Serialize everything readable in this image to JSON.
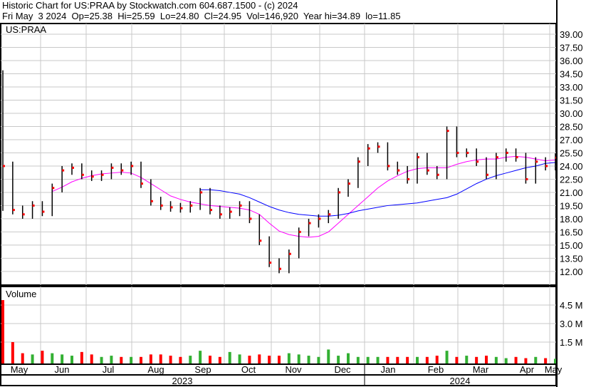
{
  "header": {
    "title": "Historic Chart for US:PRAA by Stockwatch.com 604.687.1500 - (c) 2024",
    "quote": "Fri May  3 2024  Op=25.38  Hi=25.59  Lo=24.80  Cl=24.95  Vol=146,920  Year hi=34.89  lo=11.85"
  },
  "chart_data": [
    {
      "type": "ohlc",
      "symbol": "US:PRAA",
      "ylim": [
        11,
        40.2
      ],
      "yticks": [
        "39.00",
        "37.50",
        "36.00",
        "34.50",
        "33.00",
        "31.50",
        "30.00",
        "28.50",
        "27.00",
        "25.50",
        "24.00",
        "22.50",
        "21.00",
        "19.50",
        "18.00",
        "16.50",
        "15.00",
        "13.50",
        "12.00"
      ],
      "first_bar": {
        "open": 25.0,
        "high": 34.89,
        "low": 18.9,
        "close": 24.0
      },
      "close": [
        24.0,
        19.0,
        18.5,
        19.5,
        18.8,
        21.5,
        23.5,
        23.8,
        23.0,
        22.8,
        23.0,
        23.8,
        23.5,
        24.0,
        22.0,
        20.0,
        19.5,
        19.3,
        19.2,
        19.5,
        21.0,
        19.0,
        18.5,
        18.8,
        19.5,
        18.0,
        15.5,
        13.0,
        12.3,
        14.0,
        16.5,
        17.5,
        18.0,
        18.5,
        21.0,
        22.0,
        24.5,
        26.0,
        26.2,
        24.0,
        23.5,
        22.5,
        25.0,
        23.5,
        23.0,
        28.0,
        25.5,
        25.5,
        24.5,
        23.0,
        25.0,
        25.5,
        25.0,
        22.5,
        24.5,
        24.0,
        24.95
      ],
      "ma_short": {
        "start_week": 5,
        "color": "#ff00ff",
        "values": [
          21.1,
          21.6,
          22.2,
          22.6,
          22.9,
          23.1,
          23.2,
          23.3,
          23.2,
          22.7,
          22.0,
          21.3,
          20.6,
          20.2,
          19.9,
          19.7,
          19.5,
          19.4,
          19.3,
          19.2,
          19.0,
          18.5,
          17.5,
          16.6,
          16.2,
          16.0,
          15.9,
          16.0,
          16.5,
          17.5,
          18.5,
          19.5,
          20.5,
          21.5,
          22.3,
          22.9,
          23.4,
          23.7,
          23.8,
          23.8,
          23.8,
          24.2,
          24.5,
          24.7,
          24.8,
          24.8,
          25.0,
          25.1,
          25.0,
          24.8,
          24.6,
          24.7
        ]
      },
      "ma_long": {
        "start_week": 20,
        "color": "#0000ff",
        "values": [
          21.3,
          21.3,
          21.2,
          21.0,
          20.8,
          20.4,
          19.9,
          19.4,
          19.0,
          18.7,
          18.5,
          18.4,
          18.3,
          18.3,
          18.4,
          18.6,
          18.9,
          19.1,
          19.3,
          19.5,
          19.6,
          19.7,
          19.8,
          20.0,
          20.2,
          20.4,
          20.8,
          21.4,
          22.0,
          22.5,
          22.9,
          23.2,
          23.5,
          23.8,
          24.0,
          24.3,
          24.4
        ]
      }
    },
    {
      "type": "bar",
      "title": "Volume",
      "unit": "M",
      "ylim": [
        0,
        5.6
      ],
      "yticks": [
        "4.5 M",
        "3.0 M",
        "1.5 M"
      ],
      "tick_values": [
        4.5,
        3.0,
        1.5
      ],
      "up_color": "#33b033",
      "down_color": "#ff0000",
      "values": [
        4.9,
        1.5,
        0.6,
        0.5,
        0.8,
        0.6,
        0.5,
        0.4,
        0.7,
        0.5,
        0.3,
        0.4,
        0.3,
        0.3,
        0.3,
        0.5,
        0.5,
        0.4,
        0.3,
        0.4,
        0.8,
        0.4,
        0.3,
        0.7,
        0.5,
        0.4,
        0.5,
        0.4,
        0.4,
        0.6,
        0.5,
        0.4,
        0.3,
        0.9,
        0.4,
        0.6,
        0.3,
        0.3,
        0.3,
        0.3,
        0.3,
        0.3,
        0.3,
        0.3,
        0.4,
        0.8,
        0.3,
        0.4,
        0.3,
        0.4,
        0.3,
        0.2,
        0.3,
        0.2,
        0.3,
        0.2,
        0.15
      ]
    }
  ],
  "x_axis": {
    "months": [
      "May",
      "Jun",
      "Jul",
      "Aug",
      "Sep",
      "Oct",
      "Nov",
      "Dec",
      "Jan",
      "Feb",
      "Mar",
      "Apr",
      "May"
    ],
    "years": [
      "2023",
      "2024"
    ]
  }
}
